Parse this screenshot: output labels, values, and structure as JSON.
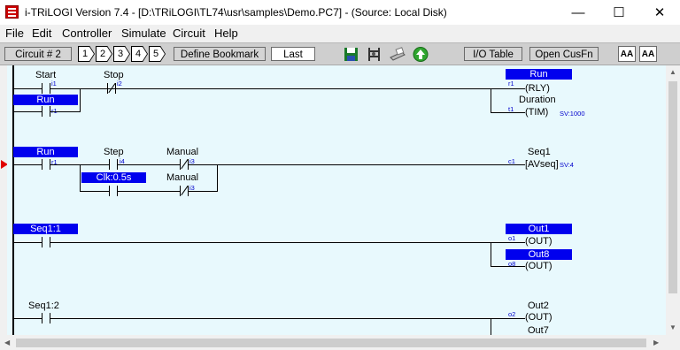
{
  "window": {
    "title": "i-TRiLOGI Version 7.4 - [D:\\TRiLOGI\\TL74\\usr\\samples\\Demo.PC7] - (Source: Local Disk)",
    "min": "—",
    "max": "☐",
    "close": "✕"
  },
  "menu": [
    "File",
    "Edit",
    "Controller",
    "Simulate",
    "Circuit",
    "Help"
  ],
  "toolbar": {
    "circuit": "Circuit # 2",
    "bookmarks": [
      "1",
      "2",
      "3",
      "4",
      "5"
    ],
    "define_bookmark": "Define Bookmark",
    "last": "Last",
    "io_table": "I/O Table",
    "open_cusfn": "Open CusFn",
    "font_up": "AA",
    "font_down": "AA",
    "icons": [
      "save-icon",
      "ladder-icon",
      "printer-icon",
      "upload-icon"
    ]
  },
  "ladder": {
    "c1": {
      "start_label": "Start",
      "start_addr": "i1",
      "run_contact": "Run",
      "run_contact_addr": "r1",
      "stop_label": "Stop",
      "stop_addr": "i2",
      "run_coil": "Run",
      "run_coil_addr": "r1",
      "run_coil_type": "(RLY)",
      "timer_label": "Duration",
      "timer_addr": "t1",
      "timer_type": "(TIM)",
      "timer_sv": "SV:1000"
    },
    "c2": {
      "run_label": "Run",
      "run_addr": "r1",
      "step_label": "Step",
      "step_addr": "i4",
      "manual_label": "Manual",
      "manual_addr": "i3",
      "clk_label": "Clk:0.5s",
      "manual2_label": "Manual",
      "manual2_addr": "i3",
      "seq_label": "Seq1",
      "seq_addr": "c1",
      "seq_type": "[AVseq]",
      "seq_sv": "SV:4"
    },
    "c3": {
      "input_label": "Seq1:1",
      "out1_label": "Out1",
      "out1_addr": "o1",
      "out1_type": "(OUT)",
      "out8_label": "Out8",
      "out8_addr": "o8",
      "out8_type": "(OUT)"
    },
    "c4": {
      "input_label": "Seq1:2",
      "out2_label": "Out2",
      "out2_addr": "o2",
      "out2_type": "(OUT)",
      "out7_label": "Out7"
    }
  }
}
